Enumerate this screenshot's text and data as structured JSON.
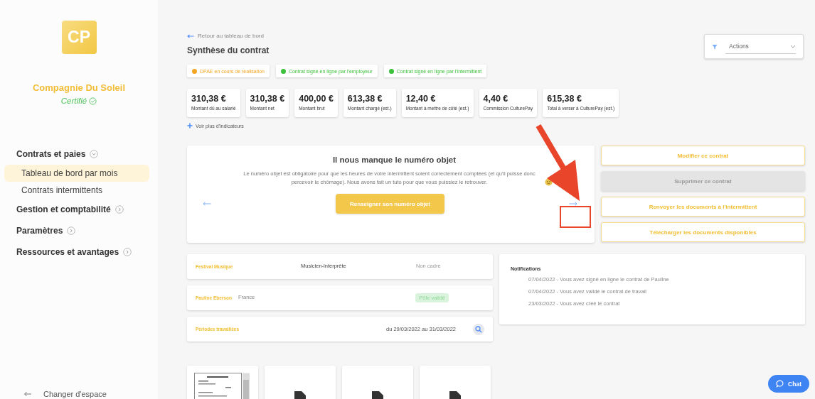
{
  "sidebar": {
    "logo": "CP",
    "company": "Compagnie Du Soleil",
    "certified": "Certifié",
    "nav": [
      {
        "label": "Contrats et paies",
        "expanded": true,
        "children": [
          {
            "label": "Tableau de bord par mois",
            "selected": true
          },
          {
            "label": "Contrats intermittents",
            "selected": false
          }
        ]
      },
      {
        "label": "Gestion et comptabilité",
        "expanded": false
      },
      {
        "label": "Paramètres",
        "expanded": false
      },
      {
        "label": "Ressources et avantages",
        "expanded": false
      }
    ],
    "footer": "Changer d'espace"
  },
  "back_link": "Retour au tableau de bord",
  "title": "Synthèse du contrat",
  "actions": {
    "label": "Actions"
  },
  "statuses": [
    {
      "label": "DPAE en cours de réalisation",
      "color": "#f5a623"
    },
    {
      "label": "Contrat signé en ligne par l'employeur",
      "color": "#3cc13b"
    },
    {
      "label": "Contrat signé en ligne par l'intermittent",
      "color": "#3cc13b"
    }
  ],
  "indicators": [
    {
      "value": "310,38 €",
      "label": "Montant dû au salarié"
    },
    {
      "value": "310,38 €",
      "label": "Montant net"
    },
    {
      "value": "400,00 €",
      "label": "Montant brut"
    },
    {
      "value": "613,38 €",
      "label": "Montant chargé (est.)"
    },
    {
      "value": "12,40 €",
      "label": "Montant à mettre de côté (est.)"
    },
    {
      "value": "4,40 €",
      "label": "Commission CulturePay"
    },
    {
      "value": "615,38 €",
      "label": "Total à verser à CulturePay (est.)"
    }
  ],
  "more_indicators": "Voir plus d'indicateurs",
  "alert": {
    "title": "Il nous manque le numéro objet",
    "text": "Le numéro objet est obligatoire pour que les heures de votre intermittent soient correctement comptées (et qu'il puisse donc percevoir le chômage). Nous avons fait un tuto pour que vous puissiez le retrouver.",
    "button": "Renseigner son numéro objet"
  },
  "buttons": [
    {
      "label": "Modifier ce contrat",
      "disabled": false
    },
    {
      "label": "Supprimer ce contrat",
      "disabled": true
    },
    {
      "label": "Renvoyer les documents à l'intermittent",
      "disabled": false
    },
    {
      "label": "Télécharger les documents disponibles",
      "disabled": false
    }
  ],
  "info_rows": [
    {
      "kind": "job",
      "title": "Festival Musique",
      "role": "Musicien-interprète",
      "status": "Non cadre"
    },
    {
      "kind": "person",
      "title": "Pauline Eberson",
      "country": "France",
      "badge": "Pôle validé"
    },
    {
      "kind": "period",
      "title": "Périodes travaillées",
      "dates": "du 29/03/2022 au 31/03/2022"
    }
  ],
  "notifications": {
    "title": "Notifications",
    "items": [
      "07/04/2022 - Vous avez signé en ligne le contrat de Pauline",
      "07/04/2022 - Vous avez validé le contrat de travail",
      "23/03/2022 - Vous avez créé le contrat"
    ]
  },
  "documents": [
    {
      "kind": "preview"
    },
    {
      "kind": "file"
    },
    {
      "kind": "file"
    },
    {
      "kind": "file"
    }
  ],
  "chat": "Chat"
}
